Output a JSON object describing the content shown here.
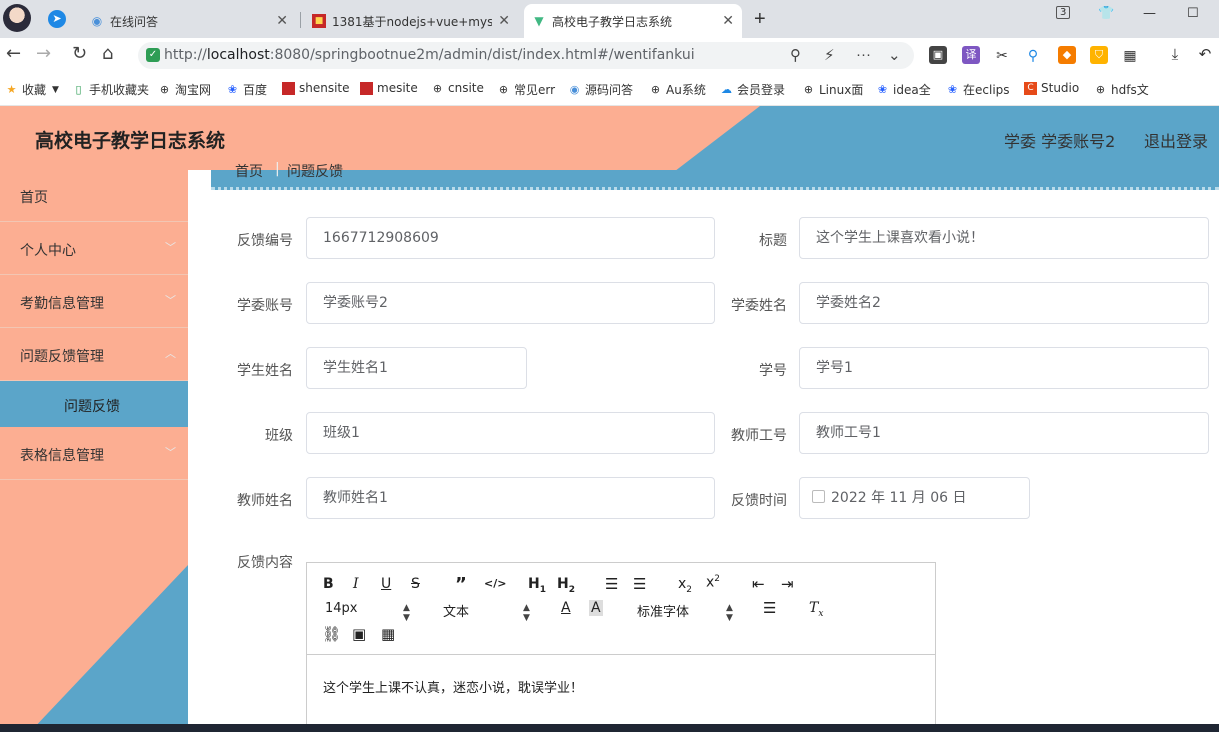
{
  "browser": {
    "tabs": [
      {
        "label": "在线问答",
        "icon": "chat-bubble-icon"
      },
      {
        "label": "1381基于nodejs+vue+mysql",
        "icon": "red-square-icon"
      },
      {
        "label": "高校电子教学日志系统",
        "icon": "vue-logo-icon"
      }
    ],
    "url_host": "localhost",
    "url_prefix": "http://",
    "url_rest": ":8080/springbootnue2m/admin/dist/index.html#/wentifankui",
    "tab_count_badge": "3",
    "bookmarks": [
      "收藏",
      "手机收藏夹",
      "淘宝网",
      "百度",
      "shensite",
      "mesite",
      "cnsite",
      "常见err",
      "源码问答",
      "Au系统",
      "会员登录",
      "Linux面",
      "idea全",
      "在eclips",
      "Studio",
      "hdfs文"
    ]
  },
  "app": {
    "title": "高校电子教学日志系统",
    "user_info": "学委 学委账号2",
    "logout_label": "退出登录"
  },
  "sidebar": {
    "items": [
      {
        "label": "首页"
      },
      {
        "label": "个人中心"
      },
      {
        "label": "考勤信息管理"
      },
      {
        "label": "问题反馈管理"
      },
      {
        "label": "问题反馈"
      },
      {
        "label": "表格信息管理"
      }
    ]
  },
  "breadcrumb": {
    "home": "首页",
    "current": "问题反馈"
  },
  "form": {
    "feedback_no_label": "反馈编号",
    "feedback_no": "1667712908609",
    "title_label": "标题",
    "title_value": "这个学生上课喜欢看小说！",
    "committee_account_label": "学委账号",
    "committee_account": "学委账号2",
    "committee_name_label": "学委姓名",
    "committee_name": "学委姓名2",
    "student_name_label": "学生姓名",
    "student_name": "学生姓名1",
    "student_no_label": "学号",
    "student_no": "学号1",
    "class_label": "班级",
    "class_value": "班级1",
    "teacher_no_label": "教师工号",
    "teacher_no": "教师工号1",
    "teacher_name_label": "教师姓名",
    "teacher_name": "教师姓名1",
    "feedback_time_label": "反馈时间",
    "feedback_time": "2022 年 11 月 06 日",
    "content_label": "反馈内容"
  },
  "editor": {
    "font_size": "14px",
    "paragraph_style": "文本",
    "font_family": "标准字体",
    "content": "这个学生上课不认真，迷恋小说，耽误学业！"
  }
}
